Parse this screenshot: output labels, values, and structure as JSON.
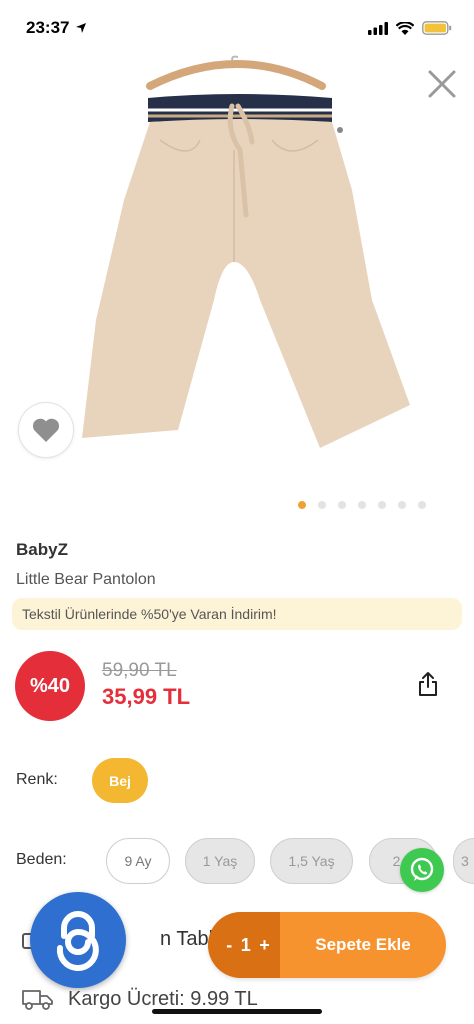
{
  "status_bar": {
    "time": "23:37"
  },
  "product": {
    "brand": "BabyZ",
    "name": "Little Bear Pantolon",
    "image_icon": "beige-baby-pants-on-hanger-image"
  },
  "gallery": {
    "dot_count": 7,
    "active_index": 0
  },
  "promo": {
    "text": "Tekstil Ürünlerinde %50'ye Varan İndirim!"
  },
  "pricing": {
    "discount_badge": "%40",
    "old_price": "59,90 TL",
    "new_price": "35,99 TL"
  },
  "color": {
    "label": "Renk:",
    "selected": "Bej"
  },
  "size": {
    "label": "Beden:",
    "options": [
      {
        "label": "9 Ay",
        "available": true
      },
      {
        "label": "1 Yaş",
        "available": false
      },
      {
        "label": "1,5 Yaş",
        "available": false
      },
      {
        "label": "2 Y",
        "available": false
      },
      {
        "label": "3",
        "available": false
      }
    ]
  },
  "size_table": {
    "label": "n Tablos"
  },
  "cart": {
    "qty_minus": "-",
    "quantity": "1",
    "qty_plus": "+",
    "add_label": "Sepete Ekle"
  },
  "shipping": {
    "label": "Kargo Ücreti: 9.99 TL"
  },
  "colors": {
    "accent_orange": "#f6932e",
    "discount_red": "#e42f3a",
    "color_chip": "#f4b731",
    "promo_bg": "#fdf4d7",
    "whatsapp_green": "#3ec951"
  }
}
